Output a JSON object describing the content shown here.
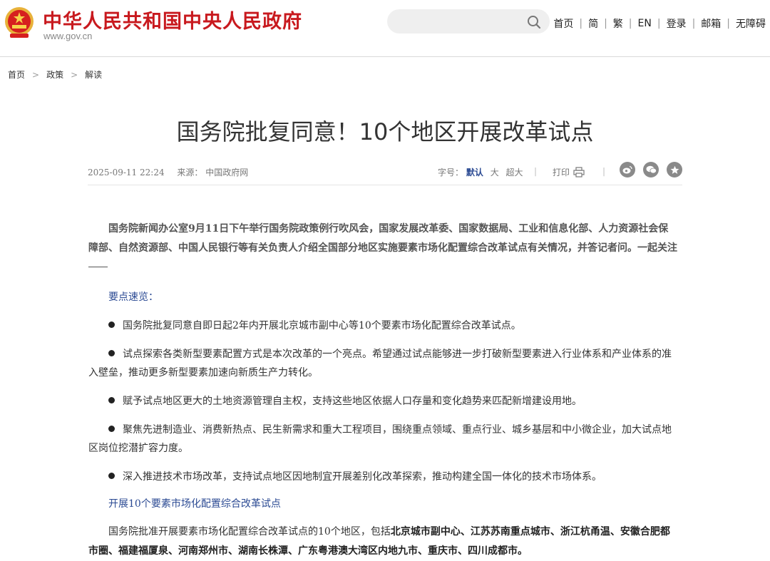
{
  "header": {
    "site_title": "中华人民共和国中央人民政府",
    "site_domain": "www.gov.cn",
    "search_placeholder": "",
    "nav": [
      "首页",
      "简",
      "繁",
      "EN",
      "登录",
      "邮箱",
      "无障碍"
    ]
  },
  "breadcrumb": [
    "首页",
    "政策",
    "解读"
  ],
  "article": {
    "title": "国务院批复同意！10个地区开展改革试点",
    "date": "2025-09-11 22:24",
    "source_label": "来源：",
    "source": "中国政府网",
    "font_size_label": "字号：",
    "font_sizes": [
      "默认",
      "大",
      "超大"
    ],
    "print_label": "打印",
    "lead": "国务院新闻办公室9月11日下午举行国务院政策例行吹风会，国家发展改革委、国家数据局、工业和信息化部、人力资源社会保障部、自然资源部、中国人民银行等有关负责人介绍全国部分地区实施要素市场化配置综合改革试点有关情况，并答记者问。一起关注",
    "summary_heading": "要点速览：",
    "bullets": [
      "国务院批复同意自即日起2年内开展北京城市副中心等10个要素市场化配置综合改革试点。",
      "试点探索各类新型要素配置方式是本次改革的一个亮点。希望通过试点能够进一步打破新型要素进入行业体系和产业体系的准入壁垒，推动更多新型要素加速向新质生产力转化。",
      "赋予试点地区更大的土地资源管理自主权，支持这些地区依据人口存量和变化趋势来匹配新增建设用地。",
      "聚焦先进制造业、消费新热点、民生新需求和重大工程项目，围绕重点领域、重点行业、城乡基层和中小微企业，加大试点地区岗位挖潜扩容力度。",
      "深入推进技术市场改革，支持试点地区因地制宜开展差别化改革探索，推动构建全国一体化的技术市场体系。"
    ],
    "section_heading": "开展10个要素市场化配置综合改革试点",
    "para_prefix": "国务院批准开展要素市场化配置综合改革试点的10个地区，包括",
    "para_bold": "北京城市副中心、江苏苏南重点城市、浙江杭甬温、安徽合肥都市圈、福建福厦泉、河南郑州市、湖南长株潭、广东粤港澳大湾区内地九市、重庆市、四川成都市。"
  },
  "colors": {
    "brand_red": "#c8191e",
    "link_blue": "#2b4a93",
    "emblem_gold": "#e8b23a"
  },
  "icons": [
    "national-emblem-icon",
    "search-icon",
    "print-icon",
    "weibo-icon",
    "wechat-icon",
    "favorite-icon"
  ]
}
